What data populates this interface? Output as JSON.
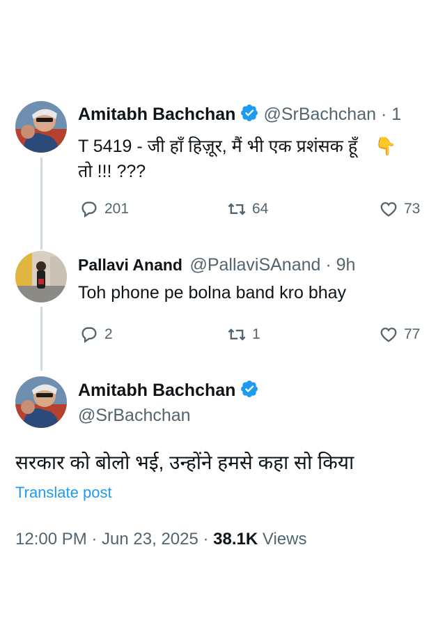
{
  "tweet1": {
    "author_name": "Amitabh Bachchan",
    "author_handle": "@SrBachchan · 1",
    "text_line1": "T 5419 - जी हाँ हिज़ूर, मैं भी एक प्रशंसक हूँ",
    "emoji": "👇",
    "text_line2": "तो !!! ???",
    "replies": "201",
    "reposts": "64",
    "likes": "73"
  },
  "tweet2": {
    "author_name": "Pallavi Anand",
    "author_handle": "@PallaviSAnand · 9h",
    "text": "Toh phone pe bolna band kro bhay",
    "replies": "2",
    "reposts": "1",
    "likes": "77"
  },
  "tweet3": {
    "author_name": "Amitabh Bachchan",
    "author_handle": "@SrBachchan",
    "text": "सरकार को बोलो भई, उन्होंने हमसे कहा सो किया",
    "translate_label": "Translate post",
    "timestamp": "12:00 PM · Jun 23, 2025 · ",
    "views_count": "38.1K",
    "views_label": " Views"
  },
  "colors": {
    "verified": "#1d9bf0",
    "link": "#1d9bf0",
    "secondary_text": "#536471",
    "thread_line": "#cfd9de"
  },
  "icons": [
    "verified-badge-icon",
    "reply-icon",
    "repost-icon",
    "like-icon",
    "pointing-down-emoji-icon"
  ]
}
